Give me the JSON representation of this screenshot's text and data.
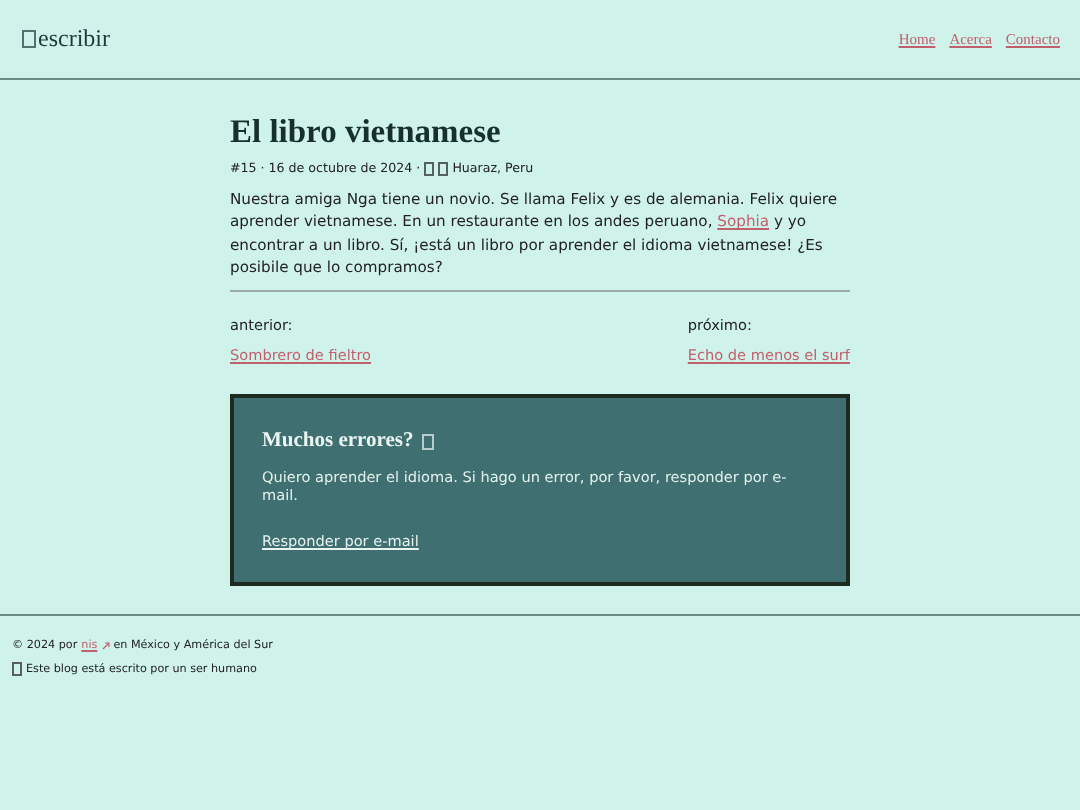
{
  "header": {
    "logo": "escribir",
    "nav": [
      "Home",
      "Acerca",
      "Contacto"
    ]
  },
  "post": {
    "title": "El libro vietnamese",
    "meta_prefix": "#15 · 16 de octubre de 2024 ·",
    "meta_place": "Huaraz, Peru",
    "body_before": "Nuestra amiga Nga tiene un novio. Se llama Felix y es de alemania. Felix quiere aprender vietnamese. En un restaurante en los andes peruano,",
    "body_link": "Sophia",
    "body_after": "y yo encontrar a un libro. Sí, ¡está un libro por aprender el idioma vietnamese! ¿Es posibile que lo compramos?"
  },
  "pagination": {
    "previous_label": "anterior:",
    "previous_link": "Sombrero de fieltro",
    "next_label": "próximo:",
    "next_link": "Echo de menos el surf"
  },
  "callout": {
    "title": "Muchos errores?",
    "text": "Quiero aprender el idioma. Si hago un error, por favor, responder por e-mail.",
    "link": "Responder por e-mail"
  },
  "footer": {
    "copyright_before": "© 2024 por",
    "author_link": "nis",
    "copyright_after": "en México y América del Sur",
    "note": "Este blog está escrito por un ser humano"
  }
}
